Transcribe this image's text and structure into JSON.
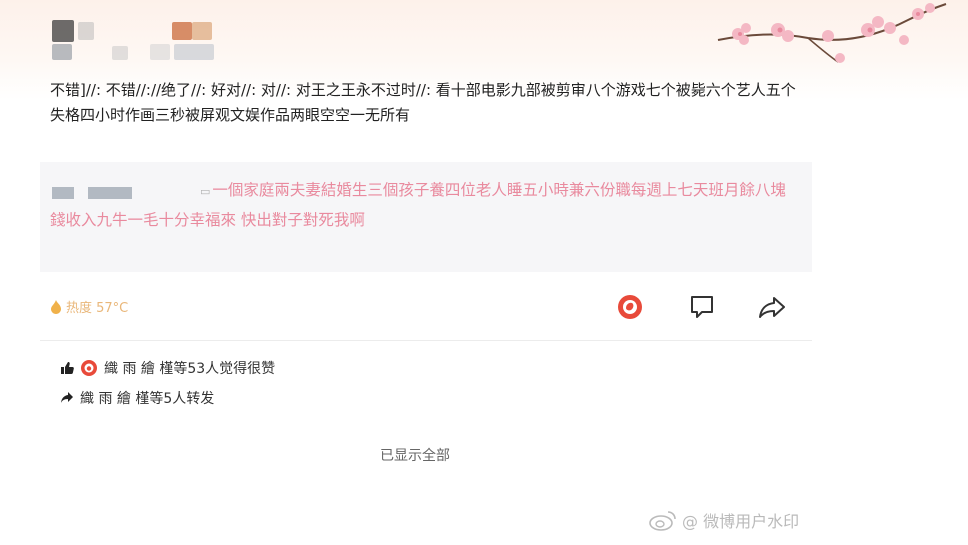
{
  "post": {
    "text": "不错]//: 不错//://绝了//: 好对//: 对//: 对王之王永不过时//: 看十部电影九部被剪审八个游戏七个被毙六个艺人五个失格四小时作画三秒被屏观文娱作品两眼空空一无所有"
  },
  "quote": {
    "text": "一個家庭兩夫妻結婚生三個孩子養四位老人睡五小時兼六份職每週上七天班月餘八塊錢收入九牛一毛十分幸福來 快出對子對死我啊"
  },
  "footer": {
    "hot_label": "热度 57°C"
  },
  "likes": {
    "text": "織 雨 繪 槿等53人觉得很赞"
  },
  "reposts": {
    "text": "織 雨 繪 槿等5人转发"
  },
  "show_all": "已显示全部",
  "watermark": "@ 微博用户水印",
  "colors": {
    "accent_pink": "#e98a9e",
    "hot_orange": "#e9b77a",
    "like_red": "#e84a3a"
  },
  "icons": [
    "fire-icon",
    "weibo-like-icon",
    "comment-icon",
    "share-icon",
    "thumb-up-icon",
    "repost-arrow-icon",
    "weibo-logo-icon"
  ]
}
